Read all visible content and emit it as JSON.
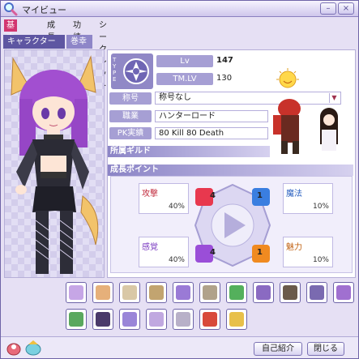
{
  "window": {
    "title": "マイビュー"
  },
  "tabs": [
    {
      "label": "基本情報",
      "active": true
    },
    {
      "label": "成長",
      "active": false
    },
    {
      "label": "功績",
      "active": false
    },
    {
      "label": "シークレット",
      "active": false
    }
  ],
  "subtabs": [
    {
      "label": "キャラクター名",
      "active": true
    },
    {
      "label": "巻幸",
      "active": false
    }
  ],
  "profile": {
    "type_label": "TYPE",
    "lv_label": "Lv",
    "lv_value": "147",
    "tmlv_label": "TM.LV",
    "tmlv_value": "130",
    "title_label": "称号",
    "title_value": "称号なし",
    "job_label": "職業",
    "job_value": "ハンターロード",
    "pk_label": "PK実績",
    "pk_value": "80 Kill  80 Death",
    "guild_label": "所属ギルド"
  },
  "growth": {
    "section_title": "成長ポイント",
    "attack_label": "攻撃",
    "attack_value": "40%",
    "magic_label": "魔法",
    "magic_value": "10%",
    "sense_label": "感覚",
    "sense_value": "40%",
    "charm_label": "魅力",
    "charm_value": "10%",
    "badge_tl": "4",
    "badge_tr": "1",
    "badge_bl": "4",
    "badge_br": "1"
  },
  "footer": {
    "intro_button": "自己紹介",
    "close_button": "閉じる"
  },
  "colors": {
    "accent": "#d23670",
    "tab_inactive": "#8e86c8",
    "frame": "#6f64a8"
  }
}
